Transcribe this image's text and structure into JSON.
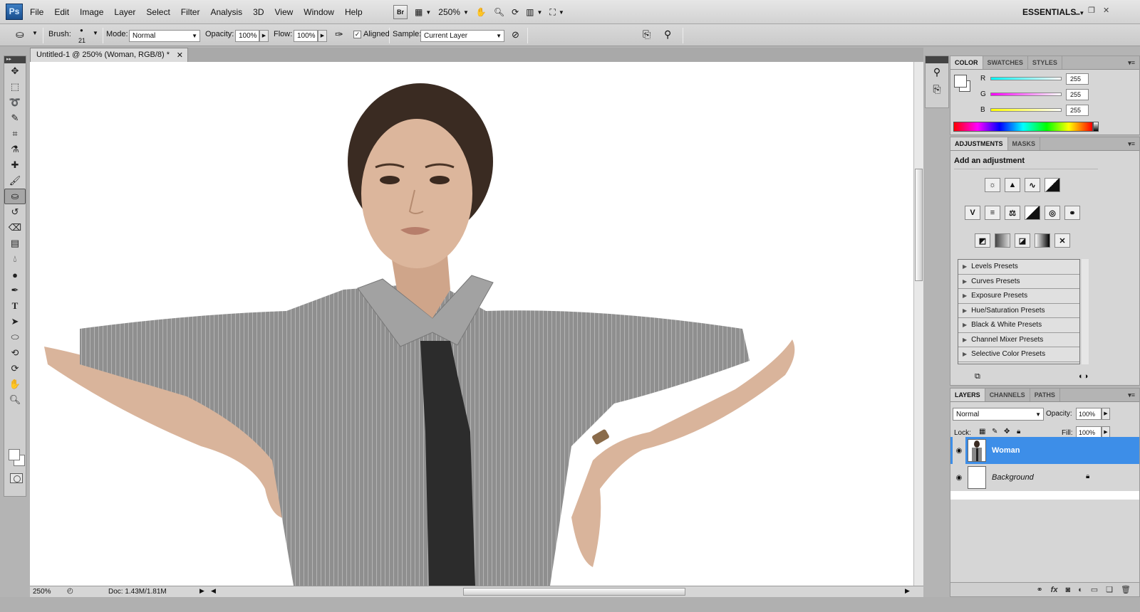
{
  "app": {
    "logo": "Ps",
    "workspace": "ESSENTIALS"
  },
  "menu": [
    "File",
    "Edit",
    "Image",
    "Layer",
    "Select",
    "Filter",
    "Analysis",
    "3D",
    "View",
    "Window",
    "Help"
  ],
  "app_bar": {
    "bridge_label": "Br",
    "zoom": "250%"
  },
  "options_bar": {
    "brush_label": "Brush:",
    "brush_size": "21",
    "mode_label": "Mode:",
    "mode_value": "Normal",
    "opacity_label": "Opacity:",
    "opacity_value": "100%",
    "flow_label": "Flow:",
    "flow_value": "100%",
    "aligned_label": "Aligned",
    "aligned_checked": true,
    "sample_label": "Sample:",
    "sample_value": "Current Layer"
  },
  "document": {
    "tab_title": "Untitled-1 @ 250% (Woman, RGB/8) *",
    "status_zoom": "250%",
    "doc_info": "Doc: 1.43M/1.81M"
  },
  "color_panel": {
    "tabs": [
      "COLOR",
      "SWATCHES",
      "STYLES"
    ],
    "channels": [
      {
        "label": "R",
        "value": "255",
        "color": "#00ffff"
      },
      {
        "label": "G",
        "value": "255",
        "color": "#ff00ff"
      },
      {
        "label": "B",
        "value": "255",
        "color": "#ffff00"
      }
    ]
  },
  "adjustments_panel": {
    "tabs": [
      "ADJUSTMENTS",
      "MASKS"
    ],
    "title": "Add an adjustment",
    "presets": [
      "Levels Presets",
      "Curves Presets",
      "Exposure Presets",
      "Hue/Saturation Presets",
      "Black & White Presets",
      "Channel Mixer Presets",
      "Selective Color Presets"
    ]
  },
  "layers_panel": {
    "tabs": [
      "LAYERS",
      "CHANNELS",
      "PATHS"
    ],
    "blend_mode": "Normal",
    "opacity_label": "Opacity:",
    "opacity_value": "100%",
    "lock_label": "Lock:",
    "fill_label": "Fill:",
    "fill_value": "100%",
    "layers": [
      {
        "name": "Woman",
        "selected": true
      },
      {
        "name": "Background",
        "selected": false,
        "locked": true
      }
    ]
  },
  "colors": {
    "selection": "#3d8ee8",
    "chrome": "#d6d6d6",
    "dark_grip": "#444444"
  }
}
